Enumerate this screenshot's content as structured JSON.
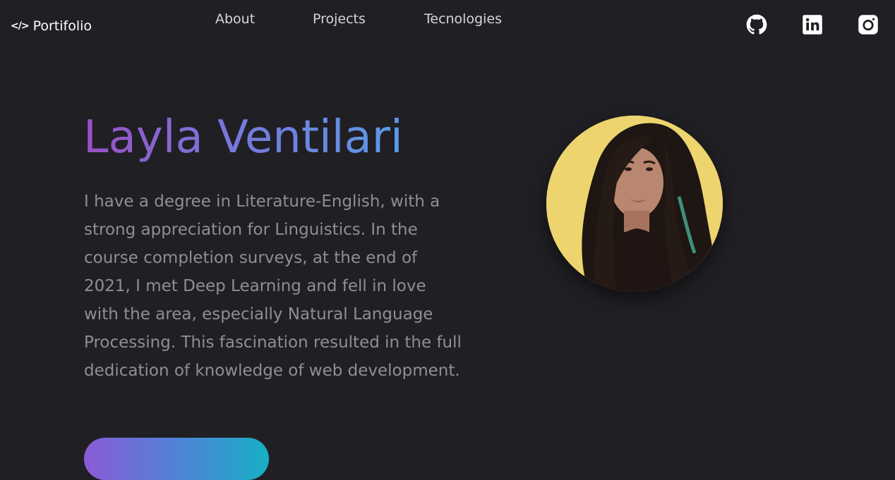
{
  "header": {
    "logo_glyph": "</>",
    "logo_text": "Portifolio",
    "nav": [
      {
        "label": "About"
      },
      {
        "label": "Projects"
      },
      {
        "label": "Tecnologies"
      }
    ],
    "social": [
      {
        "icon": "github-icon"
      },
      {
        "icon": "linkedin-icon"
      },
      {
        "icon": "instagram-icon"
      }
    ]
  },
  "hero": {
    "name": "Layla Ventilari",
    "bio": "I have a degree in Literature-English, with a strong appreciation for Linguistics. In the course completion surveys, at the end of 2021, I met Deep Learning and fell in love with the area, especially Natural Language Processing. This fascination resulted in the full dedication of knowledge of web development.",
    "colors": {
      "background": "#201f24",
      "name_gradient_start": "#9b4fc4",
      "name_gradient_end": "#5a9be8",
      "bio_text": "#8f8f93",
      "avatar_background": "#eed46f"
    }
  }
}
